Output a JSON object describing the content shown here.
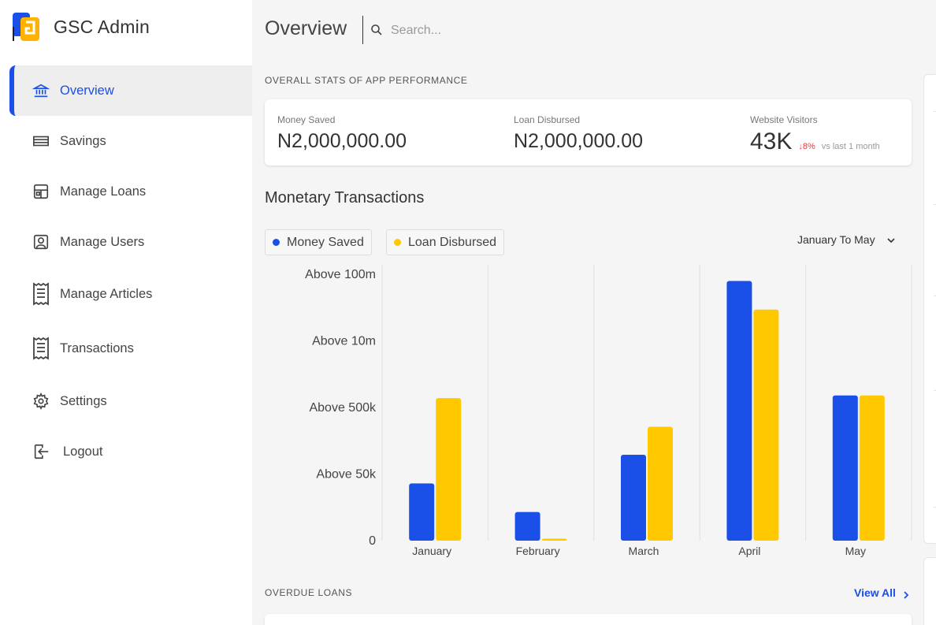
{
  "app": {
    "title": "GSC Admin"
  },
  "sidebar": {
    "items": [
      {
        "label": "Overview",
        "icon": "bank-icon",
        "active": true
      },
      {
        "label": "Savings",
        "icon": "savings-icon",
        "active": false
      },
      {
        "label": "Manage Loans",
        "icon": "loans-icon",
        "active": false
      },
      {
        "label": "Manage Users",
        "icon": "user-icon",
        "active": false
      },
      {
        "label": "Manage Articles",
        "icon": "receipt-icon",
        "active": false
      },
      {
        "label": "Transactions",
        "icon": "receipt-icon",
        "active": false
      },
      {
        "label": "Settings",
        "icon": "gear-icon",
        "active": false
      },
      {
        "label": "Logout",
        "icon": "logout-icon",
        "active": false
      }
    ]
  },
  "header": {
    "title": "Overview",
    "search_placeholder": "Search..."
  },
  "stats": {
    "section_label": "OVERALL STATS OF APP PERFORMANCE",
    "money_saved": {
      "label": "Money Saved",
      "value": "N2,000,000.00"
    },
    "loan_disbursed": {
      "label": "Loan Disbursed",
      "value": "N2,000,000.00"
    },
    "website_visitors": {
      "label": "Website Visitors",
      "value": "43K",
      "delta": "↓8%",
      "delta_note": "vs last 1 month"
    }
  },
  "transactions": {
    "title": "Monetary Transactions",
    "range": "January To May"
  },
  "chart_data": {
    "type": "bar",
    "categories": [
      "January",
      "February",
      "March",
      "April",
      "May"
    ],
    "y_ticks": [
      "0",
      "Above 50k",
      "Above 500k",
      "Above 10m",
      "Above 100m"
    ],
    "ylim": [
      0,
      4
    ],
    "series": [
      {
        "name": "Money Saved",
        "color": "#1a4fe8",
        "values": [
          0.86,
          0.43,
          1.29,
          3.9,
          2.18
        ]
      },
      {
        "name": "Loan Disbursed",
        "color": "#ffc800",
        "values": [
          2.14,
          0.03,
          1.71,
          3.47,
          2.18
        ]
      }
    ],
    "grid": "vertical",
    "legend": "top-left"
  },
  "overdue": {
    "section_label": "OVERDUE LOANS",
    "view_all": "View All"
  },
  "colors": {
    "accent": "#1a4fe8",
    "secondary": "#ffc800",
    "negative": "#e53935"
  }
}
